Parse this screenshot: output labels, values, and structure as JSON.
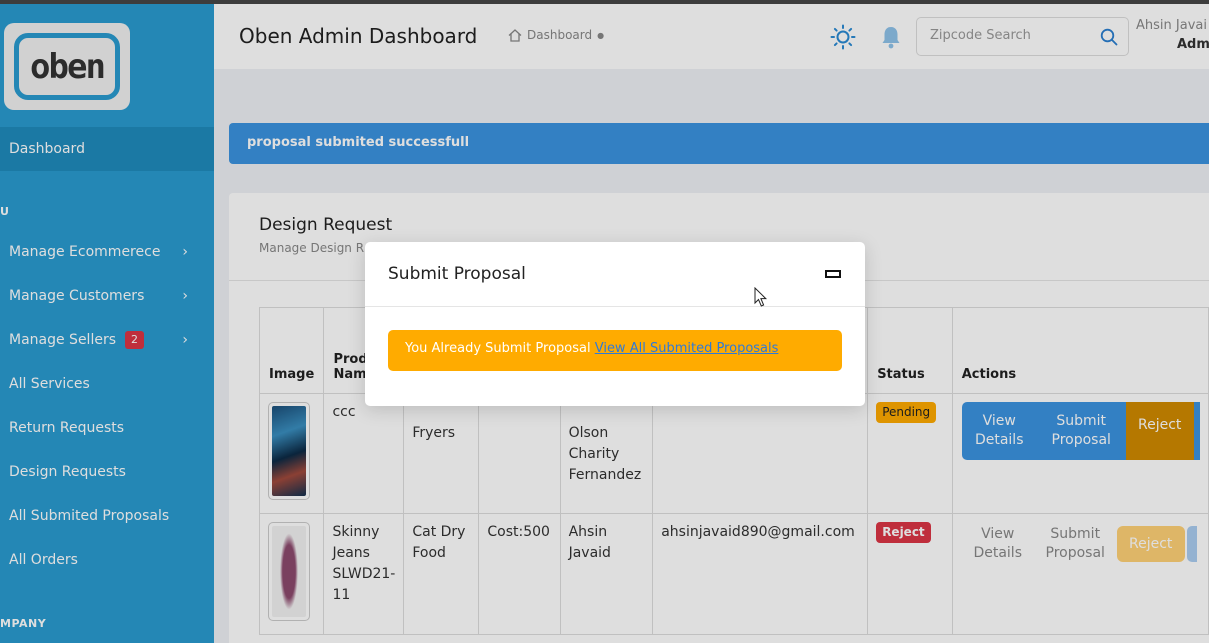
{
  "brand": {
    "logo_text": "oben"
  },
  "sidebar": {
    "items": [
      {
        "label": "Dashboard"
      },
      {
        "label": "Manage Ecommerece"
      },
      {
        "label": "Manage Customers"
      },
      {
        "label": "Manage Sellers",
        "badge": "2"
      },
      {
        "label": "All Services"
      },
      {
        "label": "Return Requests"
      },
      {
        "label": "Design Requests"
      },
      {
        "label": "All Submited Proposals"
      },
      {
        "label": "All Orders"
      }
    ],
    "section_menu": "U",
    "section_company": "MPANY"
  },
  "header": {
    "title": "Oben Admin Dashboard",
    "breadcrumb": "Dashboard",
    "search_placeholder": "Zipcode Search",
    "user_name": "Ahsin Javai",
    "user_role": "Adm"
  },
  "alert": {
    "message": "proposal submited successfull"
  },
  "card": {
    "title": "Design Request",
    "subtitle": "Manage Design R"
  },
  "table": {
    "headers": [
      "Image",
      "Produ",
      "Nam",
      "Status",
      "Actions"
    ],
    "rows": [
      {
        "name": "ccc",
        "category": "Fryers",
        "customer": [
          "Olson",
          "Charity",
          "Fernandez"
        ],
        "status": "Pending",
        "actions": [
          "View Details",
          "Submit Proposal",
          "Reject"
        ]
      },
      {
        "name": [
          "Skinny",
          "Jeans",
          "SLWD21-",
          "11"
        ],
        "category": [
          "Cat Dry",
          "Food"
        ],
        "cost": "Cost:500",
        "customer": [
          "Ahsin",
          "Javaid"
        ],
        "email": "ahsinjavaid890@gmail.com",
        "status": "Reject",
        "actions": [
          "View Details",
          "Submit Proposal",
          "Reject"
        ]
      }
    ]
  },
  "modal": {
    "title": "Submit Proposal",
    "alert_text": "You Already Submit Proposal",
    "alert_link": "View All Submited Proposals"
  },
  "colors": {
    "sidebar": "#2a9bd0",
    "primary": "#3b93e0",
    "warning": "#ffab00",
    "danger": "#dc3545"
  }
}
